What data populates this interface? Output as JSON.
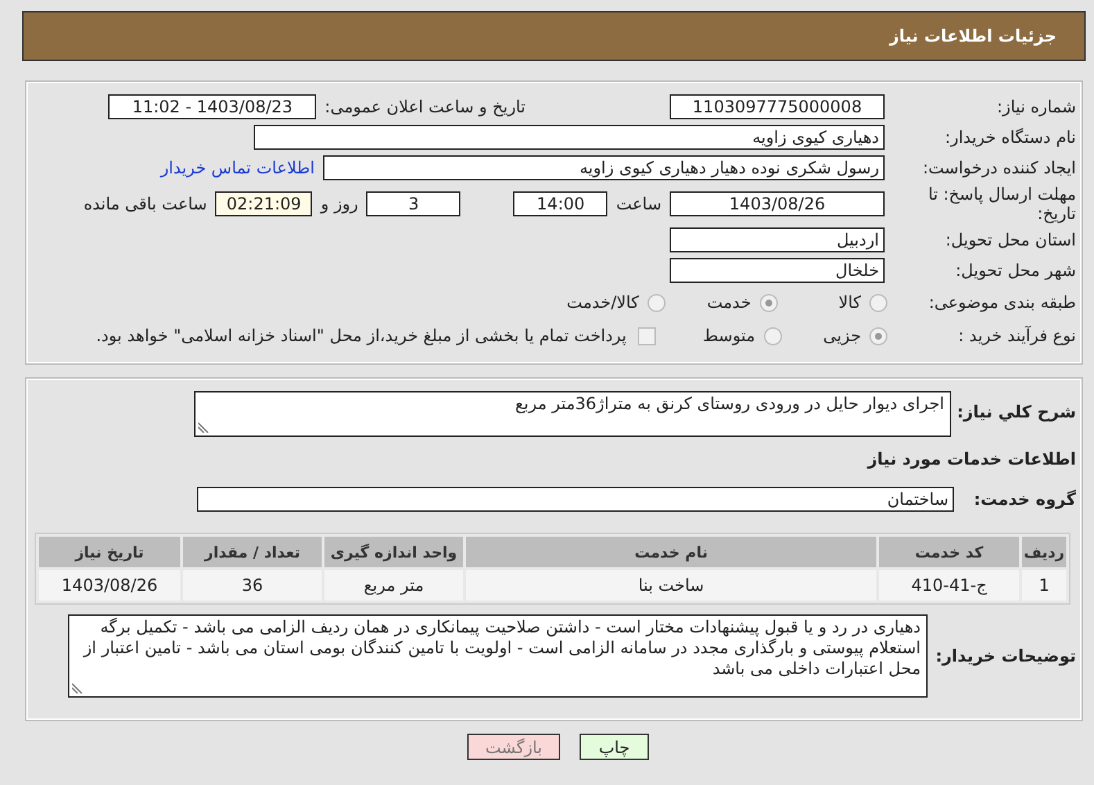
{
  "header": {
    "title": "جزئیات اطلاعات نیاز"
  },
  "need_number": {
    "label": "شماره نیاز:",
    "value": "1103097775000008"
  },
  "announce": {
    "label": "تاریخ و ساعت اعلان عمومی:",
    "value": "1403/08/23 - 11:02"
  },
  "buyer": {
    "label": "نام دستگاه خریدار:",
    "value": "دهیاری کیوی زاویه"
  },
  "creator": {
    "label": "ایجاد کننده درخواست:",
    "value": "رسول شکری نوده دهیار دهیاری کیوی زاویه",
    "link": "اطلاعات تماس خریدار"
  },
  "deadline": {
    "label": "مهلت ارسال پاسخ: تا تاریخ:",
    "date": "1403/08/26",
    "time_label": "ساعت",
    "time": "14:00",
    "days": "3",
    "days_label": "روز و",
    "remaining": "02:21:09",
    "remaining_label": "ساعت باقی مانده"
  },
  "province": {
    "label": "استان محل تحویل:",
    "value": "اردبیل"
  },
  "city": {
    "label": "شهر محل تحویل:",
    "value": "خلخال"
  },
  "category": {
    "label": "طبقه بندی موضوعی:",
    "options": [
      {
        "label": "کالا",
        "selected": false
      },
      {
        "label": "خدمت",
        "selected": true
      },
      {
        "label": "کالا/خدمت",
        "selected": false
      }
    ]
  },
  "purchase_type": {
    "label": "نوع فرآیند خرید :",
    "options": [
      {
        "label": "جزیی",
        "selected": true
      },
      {
        "label": "متوسط",
        "selected": false
      }
    ],
    "payment": {
      "checked": false,
      "text": "پرداخت تمام یا بخشی از مبلغ خرید،از محل \"اسناد خزانه اسلامی\" خواهد بود."
    }
  },
  "description": {
    "label": "شرح کلي نیاز:",
    "value": "اجرای دیوار حایل در ورودی روستای کرنق به متراژ36متر مربع"
  },
  "services_heading": "اطلاعات خدمات مورد نیاز",
  "service_group": {
    "label": "گروه خدمت:",
    "value": "ساختمان"
  },
  "table": {
    "columns": [
      "ردیف",
      "کد خدمت",
      "نام خدمت",
      "واحد اندازه گیری",
      "تعداد / مقدار",
      "تاریخ نیاز"
    ],
    "rows": [
      [
        "1",
        "ج-41-410",
        "ساخت بنا",
        "متر مربع",
        "36",
        "1403/08/26"
      ]
    ]
  },
  "buyer_notes": {
    "label": "توضیحات خریدار:",
    "value": "دهیاری در رد و یا قبول پیشنهادات مختار است - داشتن صلاحیت پیمانکاری در همان ردیف الزامی می باشد - تکمیل برگه استعلام پیوستی و بارگذاری مجدد در سامانه الزامی است - اولویت با تامین کنندگان بومی استان می باشد - تامین اعتبار از محل اعتبارات داخلی می باشد"
  },
  "buttons": [
    {
      "label": "چاپ",
      "kind": "print"
    },
    {
      "label": "بازگشت",
      "kind": "back"
    }
  ]
}
